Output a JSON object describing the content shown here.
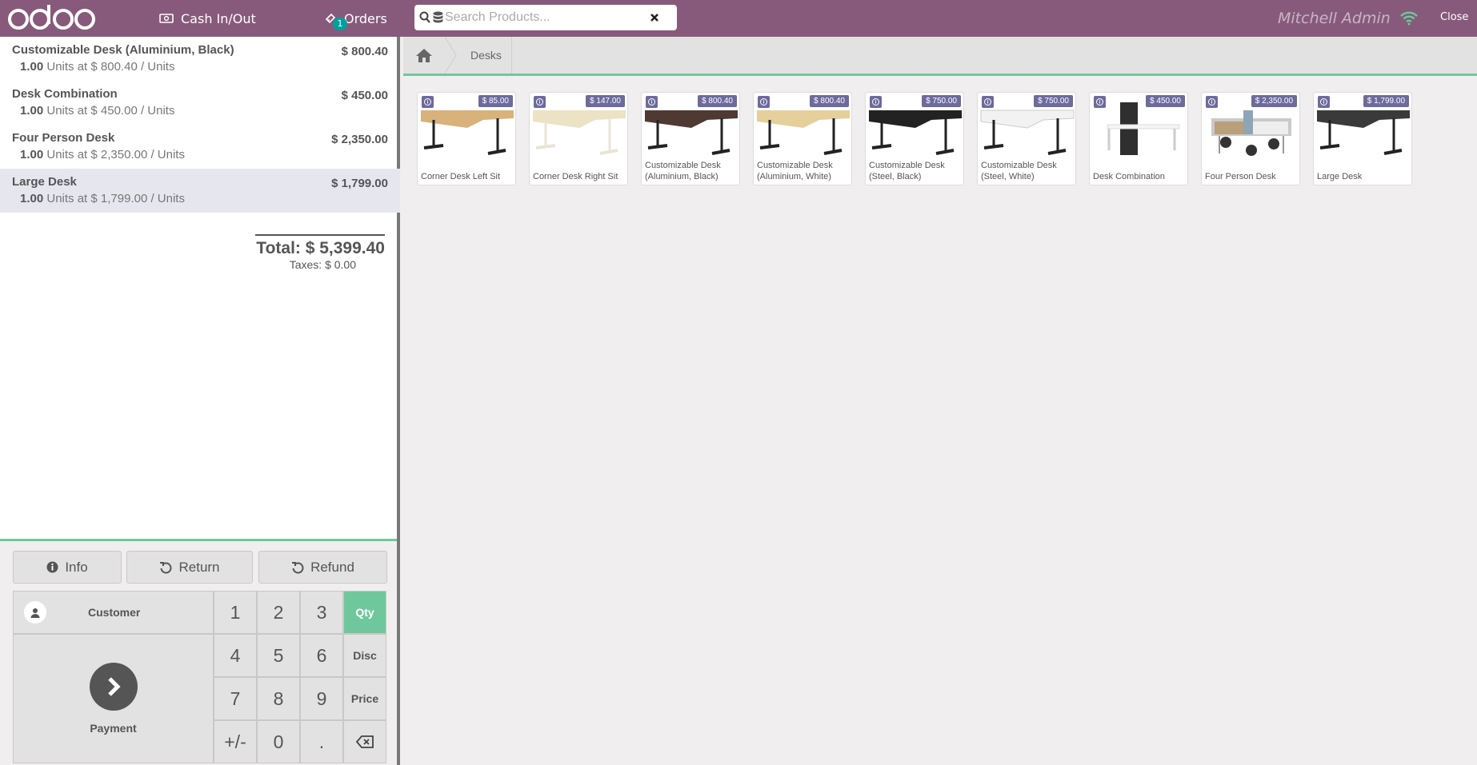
{
  "header": {
    "cash_label": "Cash In/Out",
    "orders_label": "Orders",
    "orders_count": "1",
    "search_placeholder": "Search Products...",
    "user_name": "Mitchell Admin",
    "close_label": "Close",
    "brand_color": "#875a7b"
  },
  "orderlines": [
    {
      "name": "Customizable Desk (Aluminium, Black)",
      "price": "$ 800.40",
      "qty": "1.00",
      "info": "Units at $ 800.40 / Units"
    },
    {
      "name": "Desk Combination",
      "price": "$ 450.00",
      "qty": "1.00",
      "info": "Units at $ 450.00 / Units"
    },
    {
      "name": "Four Person Desk",
      "price": "$ 2,350.00",
      "qty": "1.00",
      "info": "Units at $ 2,350.00 / Units"
    },
    {
      "name": "Large Desk",
      "price": "$ 1,799.00",
      "qty": "1.00",
      "info": "Units at $ 1,799.00 / Units"
    }
  ],
  "summary": {
    "total": "Total: $ 5,399.40",
    "taxes": "Taxes: $ 0.00"
  },
  "controls": {
    "info_label": "Info",
    "return_label": "Return",
    "refund_label": "Refund",
    "customer_label": "Customer",
    "payment_label": "Payment"
  },
  "numpad": {
    "keys": [
      "1",
      "2",
      "3",
      "4",
      "5",
      "6",
      "7",
      "8",
      "9",
      "+/-",
      "0",
      "."
    ],
    "modes": [
      "Qty",
      "Disc",
      "Price"
    ],
    "active_mode": "Qty",
    "accent_color": "#6ec89b"
  },
  "breadcrumb": {
    "category": "Desks"
  },
  "products": [
    {
      "name": "Corner Desk Left Sit",
      "price": "$ 85.00",
      "top": "#d8b27a",
      "legs": "#222"
    },
    {
      "name": "Corner Desk Right Sit",
      "price": "$ 147.00",
      "top": "#ece2c4",
      "legs": "#e8e4d6"
    },
    {
      "name": "Customizable Desk (Aluminium, Black)",
      "price": "$ 800.40",
      "top": "#4e3a33",
      "legs": "#222"
    },
    {
      "name": "Customizable Desk (Aluminium, White)",
      "price": "$ 800.40",
      "top": "#e5cf9a",
      "legs": "#222"
    },
    {
      "name": "Customizable Desk (Steel, Black)",
      "price": "$ 750.00",
      "top": "#222",
      "legs": "#222"
    },
    {
      "name": "Customizable Desk (Steel, White)",
      "price": "$ 750.00",
      "top": "#f2f2f2",
      "legs": "#222"
    },
    {
      "name": "Desk Combination",
      "price": "$ 450.00",
      "top": "#f4f4f4",
      "legs": "#ccc"
    },
    {
      "name": "Four Person Desk",
      "price": "$ 2,350.00",
      "top": "#b9a07a",
      "legs": "#999"
    },
    {
      "name": "Large Desk",
      "price": "$ 1,799.00",
      "top": "#3a3a3a",
      "legs": "#222"
    }
  ]
}
